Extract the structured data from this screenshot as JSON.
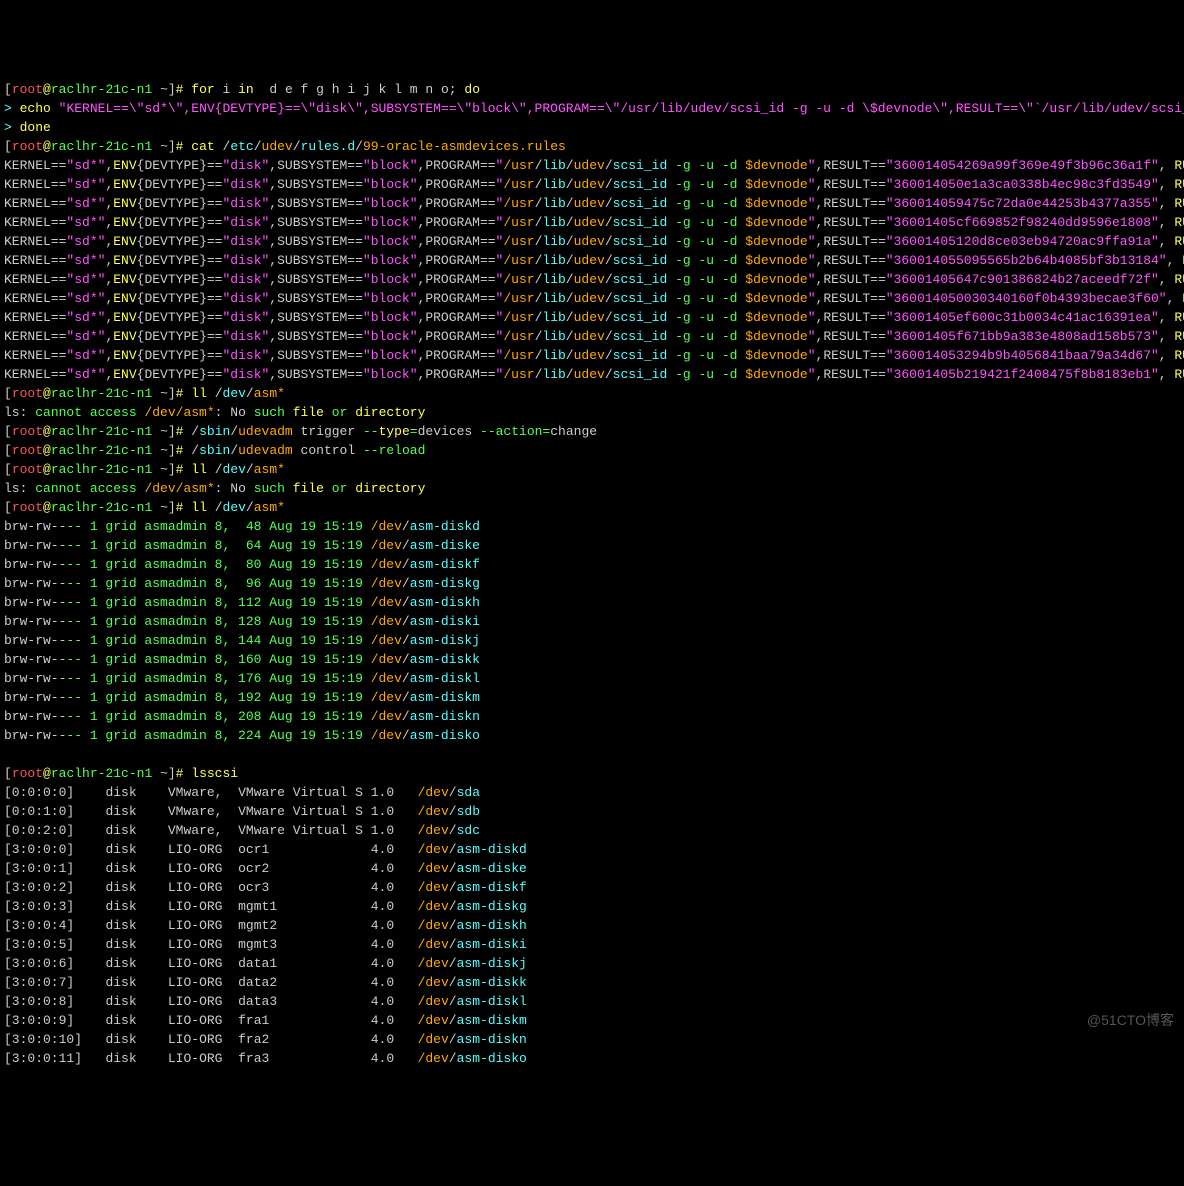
{
  "prompt": {
    "user": "root",
    "host": "raclhr-21c-n1",
    "path": "~"
  },
  "cmd_loop1": "for i in  d e f g h i j k l m n o; do",
  "cmd_loop2": "echo \"KERNEL==\\\"sd*\\\",ENV{DEVTYPE}==\\\"disk\\\",SUBSYSTEM==\\\"block\\\",PROGRAM==\\\"/usr/lib/udev/scsi_id -g -u -d \\$devnode\\\",RESULT==\\\"`/usr/lib/udev/scsi_id",
  "cmd_loop3": "done",
  "cmd_cat": "cat /etc/udev/rules.d/99-oracle-asmdevices.rules",
  "udev_prefix": {
    "kernel": "sd*",
    "devtype": "disk",
    "subsystem": "block",
    "program": "/usr/lib/udev/scsi_id -g -u -d $devnode"
  },
  "udev_results": [
    "360014054269a99f369e49f3b96c36a1f",
    "360014050e1a3ca0338b4ec98c3fd3549",
    "360014059475c72da0e44253b4377a355",
    "36001405cf669852f98240dd9596e1808",
    "36001405120d8ce03eb94720ac9ffa91a",
    "360014055095565b2b64b4085bf3b13184",
    "36001405647c901386824b27aceedf72f",
    "360014050030340160f0b4393becae3f60",
    "36001405ef600c31b0034c41ac16391ea",
    "36001405f671bb9a383e4808ad158b573",
    "360014053294b9b4056841baa79a34d67",
    "36001405b219421f2408475f8b8183eb1"
  ],
  "run_suffix": "RUN+=",
  "cmd_ll": "ll /dev/asm*",
  "ls_error": "ls: cannot access /dev/asm*: No such file or directory",
  "cmd_trigger": "/sbin/udevadm trigger --type=devices --action=change",
  "cmd_reload": "/sbin/udevadm control --reload",
  "ll_entries": [
    {
      "perm": "brw-rw----",
      "n": "1",
      "user": "grid",
      "grp": "asmadmin",
      "maj": "8,",
      "min": " 48",
      "date": "Aug 19 15:19",
      "name": "/dev/asm-diskd"
    },
    {
      "perm": "brw-rw----",
      "n": "1",
      "user": "grid",
      "grp": "asmadmin",
      "maj": "8,",
      "min": " 64",
      "date": "Aug 19 15:19",
      "name": "/dev/asm-diske"
    },
    {
      "perm": "brw-rw----",
      "n": "1",
      "user": "grid",
      "grp": "asmadmin",
      "maj": "8,",
      "min": " 80",
      "date": "Aug 19 15:19",
      "name": "/dev/asm-diskf"
    },
    {
      "perm": "brw-rw----",
      "n": "1",
      "user": "grid",
      "grp": "asmadmin",
      "maj": "8,",
      "min": " 96",
      "date": "Aug 19 15:19",
      "name": "/dev/asm-diskg"
    },
    {
      "perm": "brw-rw----",
      "n": "1",
      "user": "grid",
      "grp": "asmadmin",
      "maj": "8,",
      "min": "112",
      "date": "Aug 19 15:19",
      "name": "/dev/asm-diskh"
    },
    {
      "perm": "brw-rw----",
      "n": "1",
      "user": "grid",
      "grp": "asmadmin",
      "maj": "8,",
      "min": "128",
      "date": "Aug 19 15:19",
      "name": "/dev/asm-diski"
    },
    {
      "perm": "brw-rw----",
      "n": "1",
      "user": "grid",
      "grp": "asmadmin",
      "maj": "8,",
      "min": "144",
      "date": "Aug 19 15:19",
      "name": "/dev/asm-diskj"
    },
    {
      "perm": "brw-rw----",
      "n": "1",
      "user": "grid",
      "grp": "asmadmin",
      "maj": "8,",
      "min": "160",
      "date": "Aug 19 15:19",
      "name": "/dev/asm-diskk"
    },
    {
      "perm": "brw-rw----",
      "n": "1",
      "user": "grid",
      "grp": "asmadmin",
      "maj": "8,",
      "min": "176",
      "date": "Aug 19 15:19",
      "name": "/dev/asm-diskl"
    },
    {
      "perm": "brw-rw----",
      "n": "1",
      "user": "grid",
      "grp": "asmadmin",
      "maj": "8,",
      "min": "192",
      "date": "Aug 19 15:19",
      "name": "/dev/asm-diskm"
    },
    {
      "perm": "brw-rw----",
      "n": "1",
      "user": "grid",
      "grp": "asmadmin",
      "maj": "8,",
      "min": "208",
      "date": "Aug 19 15:19",
      "name": "/dev/asm-diskn"
    },
    {
      "perm": "brw-rw----",
      "n": "1",
      "user": "grid",
      "grp": "asmadmin",
      "maj": "8,",
      "min": "224",
      "date": "Aug 19 15:19",
      "name": "/dev/asm-disko"
    }
  ],
  "cmd_lsscsi": "lsscsi",
  "scsi": [
    {
      "id": "[0:0:0:0]",
      "type": "disk",
      "vendor": "VMware, ",
      "model": "VMware Virtual S",
      "rev": "1.0 ",
      "dev": "/dev/sda"
    },
    {
      "id": "[0:0:1:0]",
      "type": "disk",
      "vendor": "VMware, ",
      "model": "VMware Virtual S",
      "rev": "1.0 ",
      "dev": "/dev/sdb"
    },
    {
      "id": "[0:0:2:0]",
      "type": "disk",
      "vendor": "VMware, ",
      "model": "VMware Virtual S",
      "rev": "1.0 ",
      "dev": "/dev/sdc"
    },
    {
      "id": "[3:0:0:0]",
      "type": "disk",
      "vendor": "LIO-ORG ",
      "model": "ocr1            ",
      "rev": "4.0 ",
      "dev": "/dev/asm-diskd"
    },
    {
      "id": "[3:0:0:1]",
      "type": "disk",
      "vendor": "LIO-ORG ",
      "model": "ocr2            ",
      "rev": "4.0 ",
      "dev": "/dev/asm-diske"
    },
    {
      "id": "[3:0:0:2]",
      "type": "disk",
      "vendor": "LIO-ORG ",
      "model": "ocr3            ",
      "rev": "4.0 ",
      "dev": "/dev/asm-diskf"
    },
    {
      "id": "[3:0:0:3]",
      "type": "disk",
      "vendor": "LIO-ORG ",
      "model": "mgmt1           ",
      "rev": "4.0 ",
      "dev": "/dev/asm-diskg"
    },
    {
      "id": "[3:0:0:4]",
      "type": "disk",
      "vendor": "LIO-ORG ",
      "model": "mgmt2           ",
      "rev": "4.0 ",
      "dev": "/dev/asm-diskh"
    },
    {
      "id": "[3:0:0:5]",
      "type": "disk",
      "vendor": "LIO-ORG ",
      "model": "mgmt3           ",
      "rev": "4.0 ",
      "dev": "/dev/asm-diski"
    },
    {
      "id": "[3:0:0:6]",
      "type": "disk",
      "vendor": "LIO-ORG ",
      "model": "data1           ",
      "rev": "4.0 ",
      "dev": "/dev/asm-diskj"
    },
    {
      "id": "[3:0:0:7]",
      "type": "disk",
      "vendor": "LIO-ORG ",
      "model": "data2           ",
      "rev": "4.0 ",
      "dev": "/dev/asm-diskk"
    },
    {
      "id": "[3:0:0:8]",
      "type": "disk",
      "vendor": "LIO-ORG ",
      "model": "data3           ",
      "rev": "4.0 ",
      "dev": "/dev/asm-diskl"
    },
    {
      "id": "[3:0:0:9]",
      "type": "disk",
      "vendor": "LIO-ORG ",
      "model": "fra1            ",
      "rev": "4.0 ",
      "dev": "/dev/asm-diskm"
    },
    {
      "id": "[3:0:0:10]",
      "type": "disk",
      "vendor": "LIO-ORG ",
      "model": "fra2            ",
      "rev": "4.0 ",
      "dev": "/dev/asm-diskn"
    },
    {
      "id": "[3:0:0:11]",
      "type": "disk",
      "vendor": "LIO-ORG ",
      "model": "fra3            ",
      "rev": "4.0 ",
      "dev": "/dev/asm-disko"
    }
  ],
  "watermark": "@51CTO博客"
}
